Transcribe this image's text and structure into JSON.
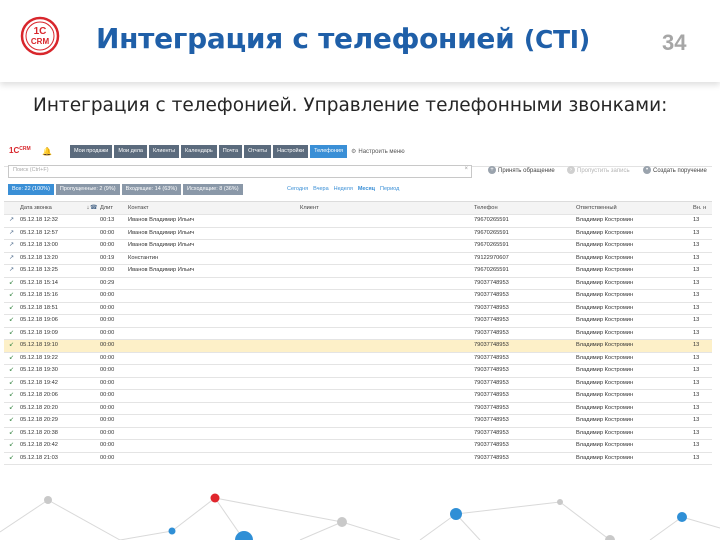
{
  "slide": {
    "title_main": "Интеграция с телефонией",
    "title_cti": "(CTI)",
    "page_number": "34",
    "subtitle": "Интеграция с телефонией. Управление телефонными звонками:",
    "logo_text": "1С CRM"
  },
  "app": {
    "crm_logo": "1С CRM",
    "menu": [
      {
        "label": "Мои продажи",
        "active": false
      },
      {
        "label": "Мои дела",
        "active": false
      },
      {
        "label": "Клиенты",
        "active": false
      },
      {
        "label": "Календарь",
        "active": false
      },
      {
        "label": "Почта",
        "active": false
      },
      {
        "label": "Отчеты",
        "active": false
      },
      {
        "label": "Настройки",
        "active": false
      },
      {
        "label": "Телефония",
        "active": true
      }
    ],
    "settings_label": "Настроить меню",
    "search_placeholder": "Поиск (Ctrl+F)",
    "toolbar": {
      "accept_call": "Принять обращение",
      "skip_record": "Пропустить запись",
      "create_task": "Создать поручение"
    },
    "filters": [
      {
        "label": "Все: 22 (100%)",
        "active": true
      },
      {
        "label": "Пропущенные: 2 (9%)",
        "active": false
      },
      {
        "label": "Входящие: 14 (63%)",
        "active": false
      },
      {
        "label": "Исходящие: 8 (36%)",
        "active": false
      }
    ],
    "periods": [
      {
        "label": "Сегодня",
        "selected": false
      },
      {
        "label": "Вчера",
        "selected": false
      },
      {
        "label": "Неделя",
        "selected": false
      },
      {
        "label": "Месяц",
        "selected": true
      },
      {
        "label": "Период",
        "selected": false
      }
    ],
    "columns": {
      "date": "Дата звонка",
      "sort_arrow": "↓",
      "duration": "Длит",
      "contact": "Контакт",
      "client": "Клиент",
      "phone": "Телефон",
      "responsible": "Ответственный",
      "ext": "Вн. н"
    },
    "rows": [
      {
        "date": "05.12.18 12:32",
        "duration": "00:13",
        "contact": "Иванов Владимир Ильич",
        "client": "",
        "phone": "79670265591",
        "responsible": "Владимир Костромин",
        "ext": "13",
        "dir": "out",
        "highlight": false
      },
      {
        "date": "05.12.18 12:57",
        "duration": "00:00",
        "contact": "Иванов Владимир Ильич",
        "client": "",
        "phone": "79670265591",
        "responsible": "Владимир Костромин",
        "ext": "13",
        "dir": "out",
        "highlight": false
      },
      {
        "date": "05.12.18 13:00",
        "duration": "00:00",
        "contact": "Иванов Владимир Ильич",
        "client": "",
        "phone": "79670265591",
        "responsible": "Владимир Костромин",
        "ext": "13",
        "dir": "out",
        "highlight": false
      },
      {
        "date": "05.12.18 13:20",
        "duration": "00:19",
        "contact": "Константин",
        "client": "",
        "phone": "79122970607",
        "responsible": "Владимир Костромин",
        "ext": "13",
        "dir": "out",
        "highlight": false
      },
      {
        "date": "05.12.18 13:25",
        "duration": "00:00",
        "contact": "Иванов Владимир Ильич",
        "client": "",
        "phone": "79670265591",
        "responsible": "Владимир Костромин",
        "ext": "13",
        "dir": "out",
        "highlight": false
      },
      {
        "date": "05.12.18 15:14",
        "duration": "00:29",
        "contact": "",
        "client": "",
        "phone": "79037748953",
        "responsible": "Владимир Костромин",
        "ext": "13",
        "dir": "in",
        "highlight": false
      },
      {
        "date": "05.12.18 15:16",
        "duration": "00:00",
        "contact": "",
        "client": "",
        "phone": "79037748953",
        "responsible": "Владимир Костромин",
        "ext": "13",
        "dir": "in",
        "highlight": false
      },
      {
        "date": "05.12.18 18:51",
        "duration": "00:00",
        "contact": "",
        "client": "",
        "phone": "79037748953",
        "responsible": "Владимир Костромин",
        "ext": "13",
        "dir": "in",
        "highlight": false
      },
      {
        "date": "05.12.18 19:06",
        "duration": "00:00",
        "contact": "",
        "client": "",
        "phone": "79037748953",
        "responsible": "Владимир Костромин",
        "ext": "13",
        "dir": "in",
        "highlight": false
      },
      {
        "date": "05.12.18 19:09",
        "duration": "00:00",
        "contact": "",
        "client": "",
        "phone": "79037748953",
        "responsible": "Владимир Костромин",
        "ext": "13",
        "dir": "in",
        "highlight": false
      },
      {
        "date": "05.12.18 19:10",
        "duration": "00:00",
        "contact": "",
        "client": "",
        "phone": "79037748953",
        "responsible": "Владимир Костромин",
        "ext": "13",
        "dir": "in",
        "highlight": true
      },
      {
        "date": "05.12.18 19:22",
        "duration": "00:00",
        "contact": "",
        "client": "",
        "phone": "79037748953",
        "responsible": "Владимир Костромин",
        "ext": "13",
        "dir": "in",
        "highlight": false
      },
      {
        "date": "05.12.18 19:30",
        "duration": "00:00",
        "contact": "",
        "client": "",
        "phone": "79037748953",
        "responsible": "Владимир Костромин",
        "ext": "13",
        "dir": "in",
        "highlight": false
      },
      {
        "date": "05.12.18 19:42",
        "duration": "00:00",
        "contact": "",
        "client": "",
        "phone": "79037748953",
        "responsible": "Владимир Костромин",
        "ext": "13",
        "dir": "in",
        "highlight": false
      },
      {
        "date": "05.12.18 20:06",
        "duration": "00:00",
        "contact": "",
        "client": "",
        "phone": "79037748953",
        "responsible": "Владимир Костромин",
        "ext": "13",
        "dir": "in",
        "highlight": false
      },
      {
        "date": "05.12.18 20:20",
        "duration": "00:00",
        "contact": "",
        "client": "",
        "phone": "79037748953",
        "responsible": "Владимир Костромин",
        "ext": "13",
        "dir": "in",
        "highlight": false
      },
      {
        "date": "05.12.18 20:29",
        "duration": "00:00",
        "contact": "",
        "client": "",
        "phone": "79037748953",
        "responsible": "Владимир Костромин",
        "ext": "13",
        "dir": "in",
        "highlight": false
      },
      {
        "date": "05.12.18 20:38",
        "duration": "00:00",
        "contact": "",
        "client": "",
        "phone": "79037748953",
        "responsible": "Владимир Костромин",
        "ext": "13",
        "dir": "in",
        "highlight": false
      },
      {
        "date": "05.12.18 20:42",
        "duration": "00:00",
        "contact": "",
        "client": "",
        "phone": "79037748953",
        "responsible": "Владимир Костромин",
        "ext": "13",
        "dir": "in",
        "highlight": false
      },
      {
        "date": "05.12.18 21:03",
        "duration": "00:00",
        "contact": "",
        "client": "",
        "phone": "79037748953",
        "responsible": "Владимир Костромин",
        "ext": "13",
        "dir": "in",
        "highlight": false
      }
    ]
  },
  "colors": {
    "title_blue": "#1f5fa8",
    "active_tab": "#3a8fd6",
    "menu_gray": "#5b6b7d",
    "highlight_row": "#fdf0c8",
    "logo_red": "#d8262c"
  }
}
